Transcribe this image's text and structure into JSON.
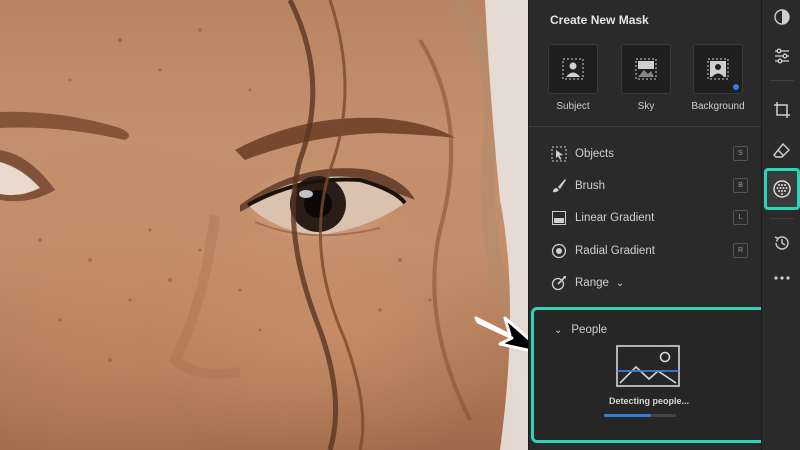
{
  "panel": {
    "title": "Create New Mask",
    "quick_masks": [
      {
        "label": "Subject",
        "icon": "subject-icon"
      },
      {
        "label": "Sky",
        "icon": "sky-icon"
      },
      {
        "label": "Background",
        "icon": "background-icon"
      }
    ],
    "tools": [
      {
        "label": "Objects",
        "shortcut": "S",
        "icon": "objects-icon"
      },
      {
        "label": "Brush",
        "shortcut": "B",
        "icon": "brush-icon"
      },
      {
        "label": "Linear Gradient",
        "shortcut": "L",
        "icon": "linear-gradient-icon"
      },
      {
        "label": "Radial Gradient",
        "shortcut": "R",
        "icon": "radial-gradient-icon"
      },
      {
        "label": "Range",
        "icon": "range-icon"
      }
    ],
    "people": {
      "label": "People",
      "status": "Detecting people...",
      "progress": 0.65
    }
  },
  "toolstrip": {
    "icons": [
      "presets-icon",
      "edit-sliders-icon",
      "crop-icon",
      "heal-eraser-icon",
      "masking-icon",
      "history-icon",
      "more-icon"
    ],
    "active": "masking-icon"
  },
  "colors": {
    "accent_highlight": "#2fd4b6",
    "progress_blue": "#2f7fe0",
    "panel_bg": "#2a2a2a"
  }
}
